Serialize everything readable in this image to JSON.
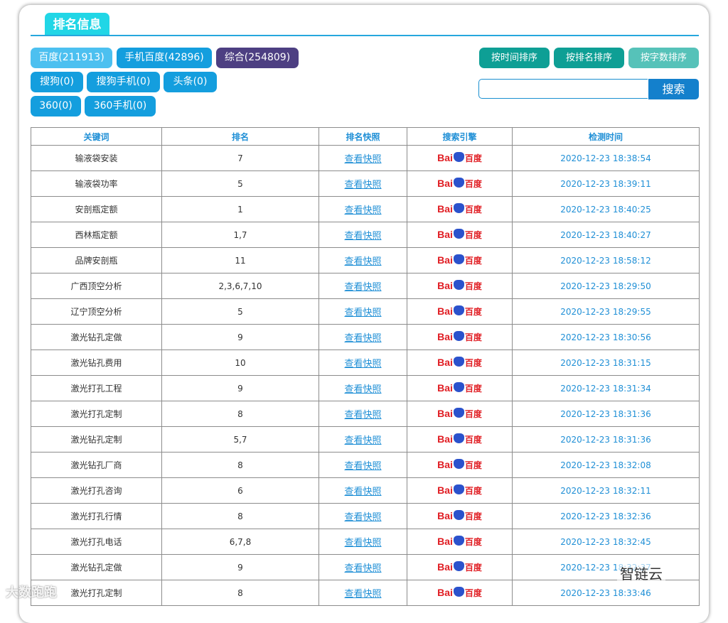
{
  "header": {
    "title": "排名信息"
  },
  "filters": {
    "baidu": "百度(211913)",
    "baidu_mobile": "手机百度(42896)",
    "combined": "综合(254809)",
    "sogou": "搜狗(0)",
    "sogou_mobile": "搜狗手机(0)",
    "toutiao": "头条(0)",
    "so360": "360(0)",
    "so360_mobile": "360手机(0)"
  },
  "sort": {
    "by_time": "按时间排序",
    "by_rank": "按排名排序",
    "by_length": "按字数排序"
  },
  "search": {
    "value": "",
    "button": "搜索"
  },
  "table": {
    "headers": [
      "关键词",
      "排名",
      "排名快照",
      "搜索引擎",
      "检测时间"
    ],
    "engine_logo": {
      "part1": "Bai",
      "part2": "百度"
    },
    "snapshot_label": "查看快照",
    "rows": [
      {
        "keyword": "输液袋安装",
        "rank": "7",
        "time": "2020-12-23 18:38:54"
      },
      {
        "keyword": "输液袋功率",
        "rank": "5",
        "time": "2020-12-23 18:39:11"
      },
      {
        "keyword": "安剖瓶定额",
        "rank": "1",
        "time": "2020-12-23 18:40:25"
      },
      {
        "keyword": "西林瓶定额",
        "rank": "1,7",
        "time": "2020-12-23 18:40:27"
      },
      {
        "keyword": "品牌安剖瓶",
        "rank": "11",
        "time": "2020-12-23 18:58:12"
      },
      {
        "keyword": "广西顶空分析",
        "rank": "2,3,6,7,10",
        "time": "2020-12-23 18:29:50"
      },
      {
        "keyword": "辽宁顶空分析",
        "rank": "5",
        "time": "2020-12-23 18:29:55"
      },
      {
        "keyword": "激光钻孔定做",
        "rank": "9",
        "time": "2020-12-23 18:30:56"
      },
      {
        "keyword": "激光钻孔费用",
        "rank": "10",
        "time": "2020-12-23 18:31:15"
      },
      {
        "keyword": "激光打孔工程",
        "rank": "9",
        "time": "2020-12-23 18:31:34"
      },
      {
        "keyword": "激光打孔定制",
        "rank": "8",
        "time": "2020-12-23 18:31:36"
      },
      {
        "keyword": "激光钻孔定制",
        "rank": "5,7",
        "time": "2020-12-23 18:31:36"
      },
      {
        "keyword": "激光钻孔厂商",
        "rank": "8",
        "time": "2020-12-23 18:32:08"
      },
      {
        "keyword": "激光打孔咨询",
        "rank": "6",
        "time": "2020-12-23 18:32:11"
      },
      {
        "keyword": "激光打孔行情",
        "rank": "8",
        "time": "2020-12-23 18:32:36"
      },
      {
        "keyword": "激光打孔电话",
        "rank": "6,7,8",
        "time": "2020-12-23 18:32:45"
      },
      {
        "keyword": "激光钻孔定做",
        "rank": "9",
        "time": "2020-12-23 18:32:37"
      },
      {
        "keyword": "激光打孔定制",
        "rank": "8",
        "time": "2020-12-23 18:33:46"
      }
    ]
  },
  "watermarks": {
    "left": "大数跑跑",
    "right": "智链云"
  },
  "colors": {
    "accent": "#21d6e6",
    "link": "#1f8fd6",
    "baidu_red": "#e01c22",
    "baidu_blue": "#2b52cc"
  }
}
